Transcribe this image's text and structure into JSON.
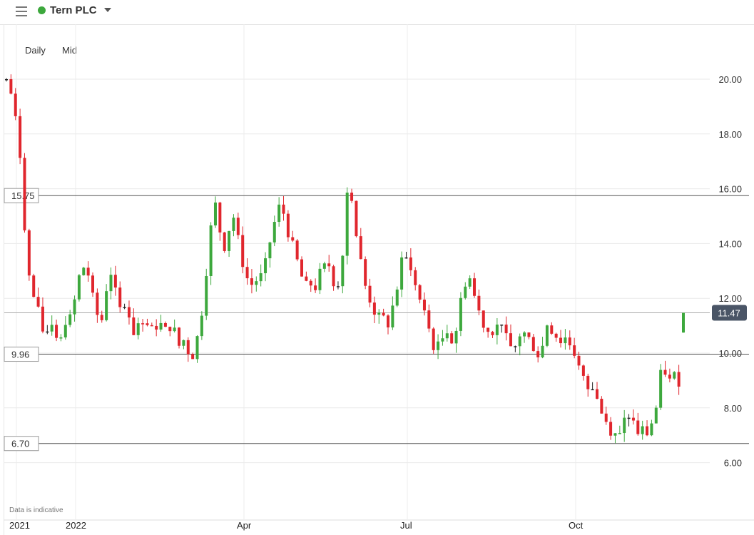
{
  "header": {
    "title": "Tern PLC",
    "status_color": "#3da83d",
    "menu_icon": "hamburger-menu-icon",
    "dropdown_icon": "caret-down-icon"
  },
  "controls": {
    "interval": "Daily",
    "price_type": "Mid"
  },
  "disclaimer": "Data is indicative",
  "chart_data": {
    "type": "candlestick",
    "y_range": [
      5.0,
      20.4
    ],
    "y_ticks": [
      "20.00",
      "18.00",
      "16.00",
      "14.00",
      "12.00",
      "10.00",
      "8.00",
      "6.00"
    ],
    "x_labels": [
      "2021",
      "2022",
      "Apr",
      "Jul",
      "Oct"
    ],
    "last_price": "11.47",
    "reference_lines": [
      {
        "label": "15.75",
        "value": 15.75
      },
      {
        "label": "9.96",
        "value": 9.96
      },
      {
        "label": "6.70",
        "value": 6.7
      }
    ],
    "colors": {
      "up": "#3da83d",
      "down": "#e0262d",
      "flat": "#222222",
      "price_badge": "#4a5566"
    },
    "close_path": [
      20.0,
      19.6,
      18.6,
      17.9,
      15.7,
      13.2,
      12.3,
      11.9,
      11.3,
      10.7,
      10.9,
      11.2,
      10.7,
      10.6,
      11.3,
      11.1,
      11.4,
      12.4,
      13.0,
      13.2,
      12.8,
      11.9,
      11.4,
      11.1,
      12.2,
      13.1,
      12.7,
      11.4,
      11.7,
      12.0,
      11.1,
      10.7,
      11.2,
      11.3,
      11.0,
      10.8,
      11.0,
      11.1,
      10.9,
      10.7,
      11.2,
      10.6,
      10.2,
      10.5,
      10.1,
      9.9,
      10.4,
      11.1,
      12.5,
      13.8,
      15.2,
      15.5,
      14.1,
      13.9,
      14.6,
      15.0,
      14.2,
      13.5,
      12.8,
      12.6,
      12.4,
      12.9,
      12.7,
      13.4,
      14.2,
      14.8,
      15.3,
      15.2,
      14.6,
      14.0,
      13.6,
      13.0,
      12.6,
      12.3,
      12.6,
      12.4,
      12.9,
      13.1,
      13.3,
      12.7,
      12.5,
      12.8,
      15.0,
      16.6,
      15.3,
      14.0,
      13.2,
      12.4,
      12.0,
      11.6,
      11.2,
      11.4,
      10.9,
      11.3,
      12.0,
      12.6,
      13.5,
      13.4,
      12.9,
      12.6,
      12.0,
      11.5,
      11.1,
      10.5,
      10.1,
      10.3,
      10.7,
      11.0,
      10.4,
      10.9,
      11.8,
      12.6,
      12.9,
      12.3,
      11.7,
      11.3,
      11.0,
      10.7,
      10.9,
      11.1,
      10.8,
      10.5,
      10.2,
      10.3,
      10.6,
      10.8,
      10.6,
      10.4,
      10.2,
      9.9,
      10.3,
      11.1,
      10.9,
      10.7,
      10.4,
      10.6,
      10.5,
      10.2,
      9.9,
      9.3,
      8.9,
      8.7,
      8.6,
      8.4,
      7.9,
      7.6,
      7.3,
      7.1,
      7.0,
      7.2,
      7.5,
      7.8,
      7.4,
      7.1,
      7.2,
      7.0,
      7.4,
      7.6,
      8.6,
      9.7,
      9.1,
      8.9,
      9.2,
      9.0,
      11.47
    ]
  }
}
